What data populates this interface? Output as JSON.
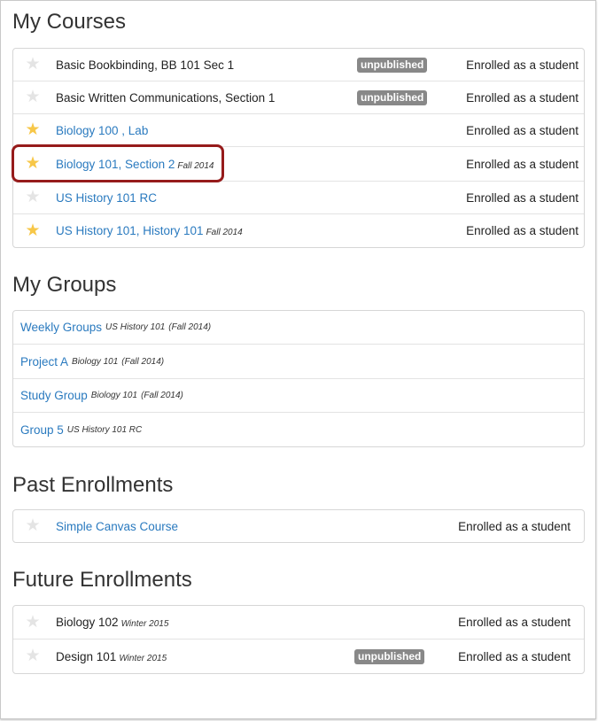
{
  "sections": {
    "my_courses": "My Courses",
    "my_groups": "My Groups",
    "past_enrollments": "Past Enrollments",
    "future_enrollments": "Future Enrollments"
  },
  "my_courses": [
    {
      "name": "Basic Bookbinding, BB 101 Sec 1",
      "term": "",
      "badge": "unpublished",
      "status": "Enrolled as a student",
      "favorite": false,
      "link": false
    },
    {
      "name": "Basic Written Communications, Section 1",
      "term": "",
      "badge": "unpublished",
      "status": "Enrolled as a student",
      "favorite": false,
      "link": false
    },
    {
      "name": "Biology 100 , Lab",
      "term": "",
      "badge": "",
      "status": "Enrolled as a student",
      "favorite": true,
      "link": true
    },
    {
      "name": "Biology 101, Section 2",
      "term": "Fall 2014",
      "badge": "",
      "status": "Enrolled as a student",
      "favorite": true,
      "link": true
    },
    {
      "name": "US History 101 RC",
      "term": "",
      "badge": "",
      "status": "Enrolled as a student",
      "favorite": false,
      "link": true
    },
    {
      "name": "US History 101, History 101",
      "term": "Fall 2014",
      "badge": "",
      "status": "Enrolled as a student",
      "favorite": true,
      "link": true
    }
  ],
  "my_groups": [
    {
      "name": "Weekly Groups",
      "course": "US History 101",
      "term": "(Fall 2014)"
    },
    {
      "name": "Project A",
      "course": "Biology 101",
      "term": "(Fall 2014)"
    },
    {
      "name": "Study Group",
      "course": "Biology 101",
      "term": "(Fall 2014)"
    },
    {
      "name": "Group 5",
      "course": "US History 101 RC",
      "term": ""
    }
  ],
  "past_enrollments": [
    {
      "name": "Simple Canvas Course",
      "term": "",
      "badge": "",
      "status": "Enrolled as a student",
      "favorite": false,
      "link": true
    }
  ],
  "future_enrollments": [
    {
      "name": "Biology 102",
      "term": "Winter 2015",
      "badge": "",
      "status": "Enrolled as a student",
      "favorite": false,
      "link": false
    },
    {
      "name": "Design 101",
      "term": "Winter 2015",
      "badge": "unpublished",
      "status": "Enrolled as a student",
      "favorite": false,
      "link": false
    }
  ],
  "icons": {
    "star": "star-icon"
  },
  "colors": {
    "link": "#2a7abf",
    "favorite_star": "#f7c748",
    "inactive_star": "#e4e4e4",
    "badge_bg": "#888888",
    "highlight": "#961b1b"
  }
}
